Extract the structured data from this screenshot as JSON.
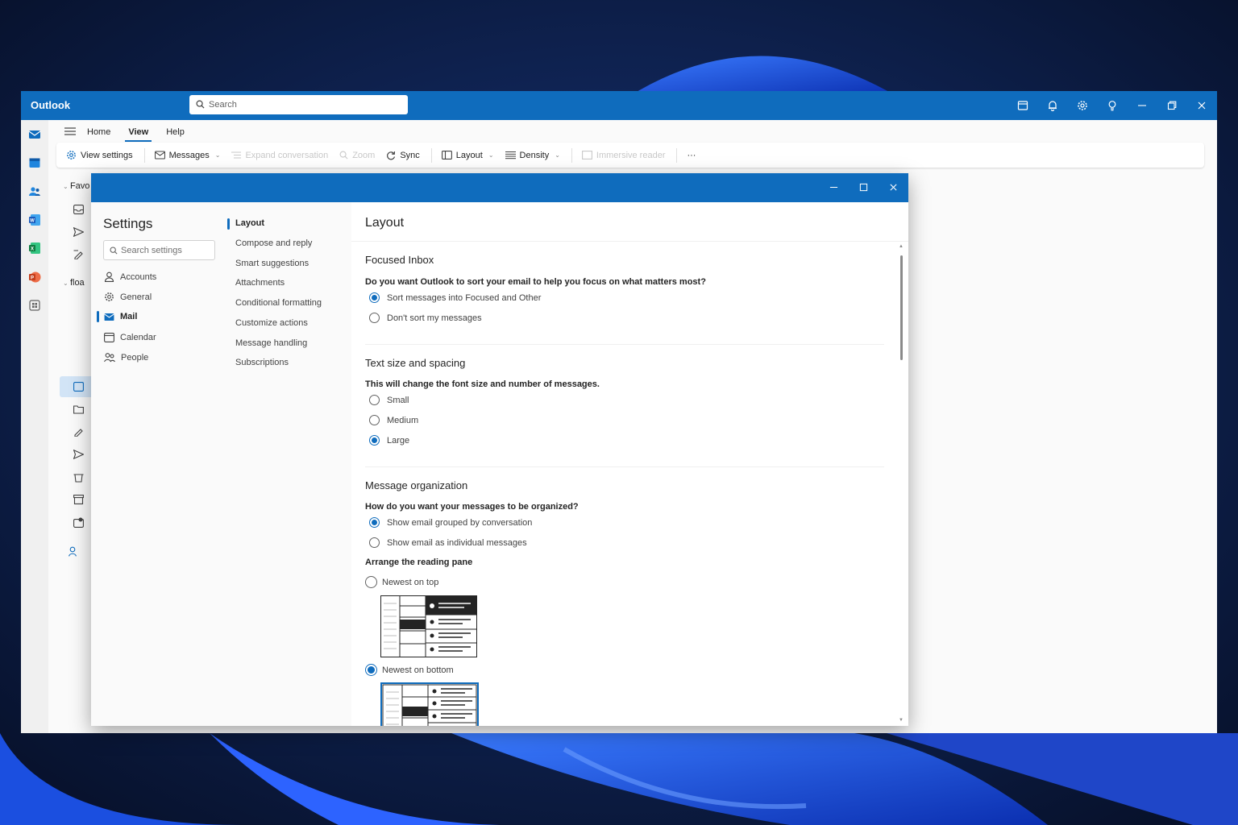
{
  "app": {
    "title": "Outlook",
    "search_placeholder": "Search",
    "accent": "#0f6cbd"
  },
  "menu_tabs": [
    {
      "label": "Home",
      "active": false
    },
    {
      "label": "View",
      "active": true
    },
    {
      "label": "Help",
      "active": false
    }
  ],
  "ribbon": {
    "view_settings": "View settings",
    "messages": "Messages",
    "expand_conversation": "Expand conversation",
    "zoom": "Zoom",
    "sync": "Sync",
    "layout": "Layout",
    "density": "Density",
    "immersive_reader": "Immersive reader",
    "more": "···"
  },
  "folder_pane": {
    "favorites_label": "Favo",
    "account_label": "floa"
  },
  "settings": {
    "title": "Settings",
    "search_placeholder": "Search settings",
    "nav": [
      {
        "label": "Accounts",
        "icon": "person-icon"
      },
      {
        "label": "General",
        "icon": "gear-icon"
      },
      {
        "label": "Mail",
        "icon": "mail-icon",
        "active": true
      },
      {
        "label": "Calendar",
        "icon": "calendar-icon"
      },
      {
        "label": "People",
        "icon": "people-icon"
      }
    ],
    "subnav": [
      {
        "label": "Layout",
        "active": true
      },
      {
        "label": "Compose and reply"
      },
      {
        "label": "Smart suggestions"
      },
      {
        "label": "Attachments"
      },
      {
        "label": "Conditional formatting"
      },
      {
        "label": "Customize actions"
      },
      {
        "label": "Message handling"
      },
      {
        "label": "Subscriptions"
      }
    ],
    "content": {
      "title": "Layout",
      "focused_inbox": {
        "title": "Focused Inbox",
        "question": "Do you want Outlook to sort your email to help you focus on what matters most?",
        "options": [
          "Sort messages into Focused and Other",
          "Don't sort my messages"
        ],
        "selected": 0
      },
      "text_size": {
        "title": "Text size and spacing",
        "question": "This will change the font size and number of messages.",
        "options": [
          "Small",
          "Medium",
          "Large"
        ],
        "selected": 2
      },
      "message_org": {
        "title": "Message organization",
        "question": "How do you want your messages to be organized?",
        "options": [
          "Show email grouped by conversation",
          "Show email as individual messages"
        ],
        "selected": 0,
        "reading_pane_label": "Arrange the reading pane",
        "reading_options": [
          "Newest on top",
          "Newest on bottom"
        ],
        "reading_selected": 1
      }
    }
  }
}
